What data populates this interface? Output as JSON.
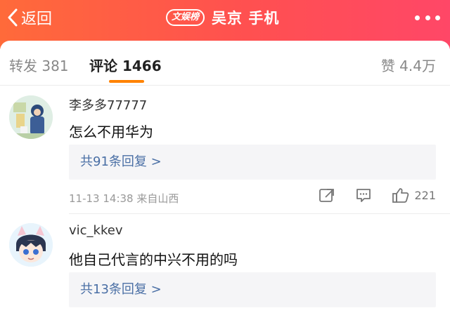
{
  "header": {
    "back_label": "返回",
    "badge": "文娱榜",
    "title": "吴京 手机"
  },
  "tabs": [
    {
      "label": "转发 381"
    },
    {
      "label": "评论 1466"
    },
    {
      "label": "赞 4.4万"
    }
  ],
  "comments": [
    {
      "username": "李多多77777",
      "text": "怎么不用华为",
      "replies": "共91条回复 >",
      "meta": "11-13 14:38  来自山西",
      "likes": "221"
    },
    {
      "username": "vic_kkev",
      "text": "他自己代言的中兴不用的吗",
      "replies": "共13条回复 >"
    }
  ],
  "colors": {
    "header_start": "#ff6a3a",
    "header_end": "#ff4767",
    "tab_underline": "#ff8200",
    "reply_link": "#4a6fa5"
  }
}
